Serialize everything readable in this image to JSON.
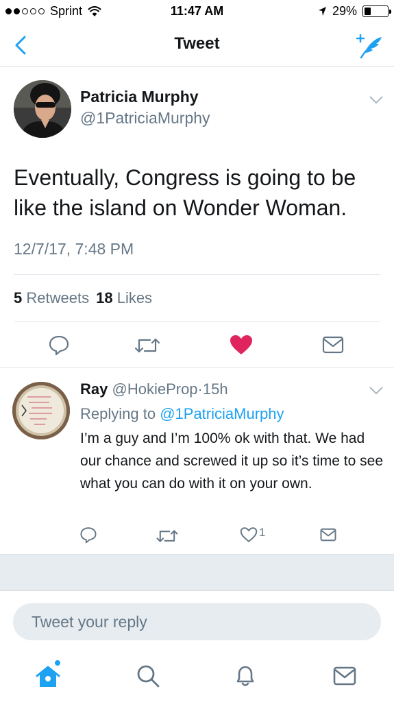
{
  "status_bar": {
    "carrier": "Sprint",
    "time": "11:47 AM",
    "battery": "29%",
    "battery_level": 0.29,
    "signal_bars": 2,
    "signal_total": 5
  },
  "nav": {
    "title": "Tweet",
    "back_icon": "chevron-left-icon",
    "compose_icon": "compose-tweet-icon"
  },
  "tweet": {
    "author_name": "Patricia Murphy",
    "author_handle": "@1PatriciaMurphy",
    "text": "Eventually, Congress is going to be like the island on Wonder Woman.",
    "date": "12/7/17, 7:48 PM",
    "retweets_count": "5",
    "retweets_label": "Retweets",
    "likes_count": "18",
    "likes_label": "Likes",
    "liked": true
  },
  "reply": {
    "author_name": "Ray",
    "author_handle": "@HokieProp",
    "separator": "·",
    "time": "15h",
    "replying_label": "Replying to",
    "replying_to": "@1PatriciaMurphy",
    "text": "I’m a guy and I’m 100% ok with that. We had our chance and screwed it up so it’s time to see what you can do with it on your own.",
    "likes_count": "1",
    "avatar_text": "MY ONLY REGRET IS I DON'T TELL MORE PEOPLE TO FUCK OFF"
  },
  "reply_box": {
    "placeholder": "Tweet your reply"
  },
  "tabs": [
    "home-icon",
    "search-icon",
    "notifications-icon",
    "messages-icon"
  ],
  "colors": {
    "accent": "#1da1f2",
    "like": "#e0245e",
    "secondary_text": "#657786",
    "divider": "#e1e8ed",
    "band": "#e6ecf0"
  }
}
